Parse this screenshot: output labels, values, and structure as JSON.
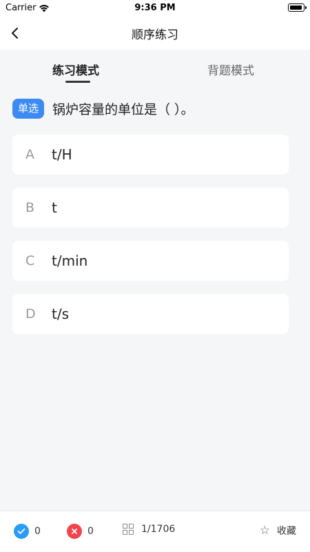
{
  "status_bar": {
    "carrier": "Carrier",
    "time": "9:36 PM"
  },
  "nav": {
    "title": "顺序练习",
    "back_icon": "chevron-left-icon"
  },
  "tabs": {
    "practice": "练习模式",
    "recite": "背题模式",
    "active": "practice"
  },
  "question": {
    "type_badge": "单选",
    "text": "锅炉容量的单位是（ ）。"
  },
  "options": [
    {
      "letter": "A",
      "text": "t/H"
    },
    {
      "letter": "B",
      "text": "t"
    },
    {
      "letter": "C",
      "text": "t/min"
    },
    {
      "letter": "D",
      "text": "t/s"
    }
  ],
  "bottom_bar": {
    "correct_count": "0",
    "wrong_count": "0",
    "progress": "1/1706",
    "favorite_label": "收藏"
  },
  "colors": {
    "accent_blue": "#3d8bf2",
    "correct": "#2a9cf5",
    "wrong": "#f0454b",
    "background": "#f5f6f8"
  }
}
